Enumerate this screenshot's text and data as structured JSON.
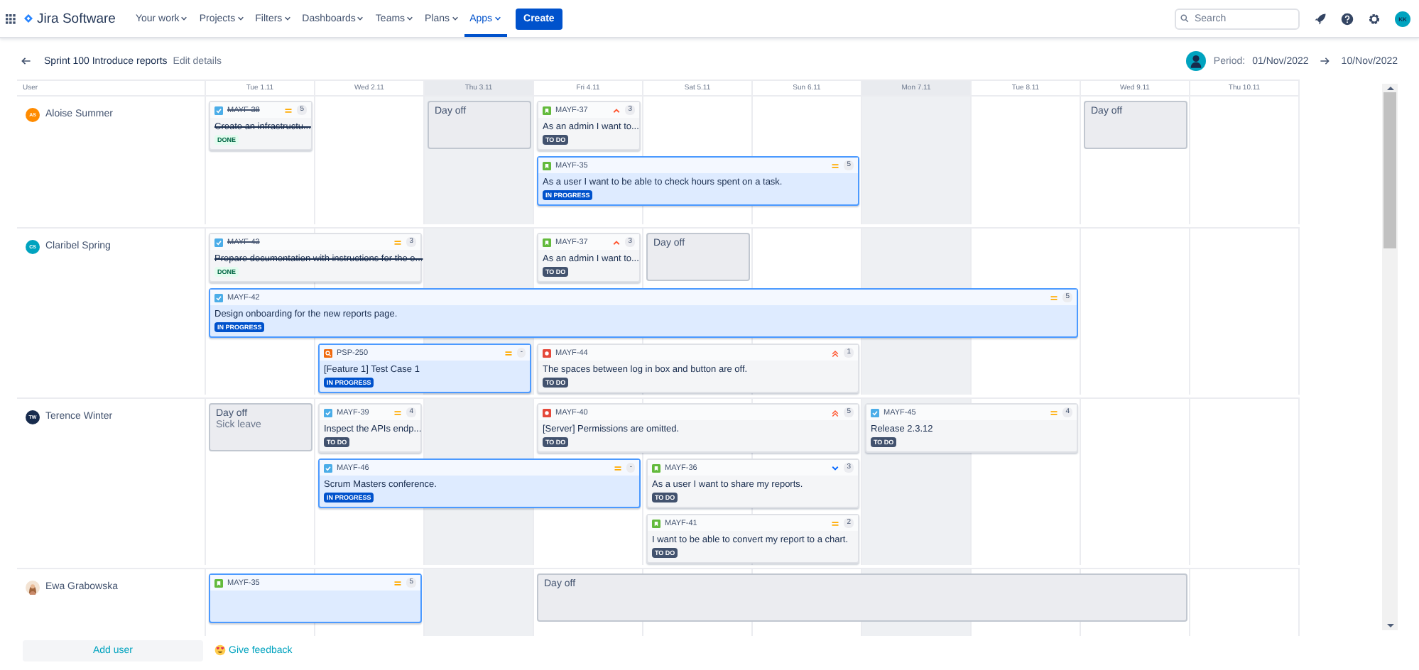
{
  "app": {
    "name": "Jira Software"
  },
  "nav": [
    {
      "label": "Your work",
      "selected": false
    },
    {
      "label": "Projects",
      "selected": false
    },
    {
      "label": "Filters",
      "selected": false
    },
    {
      "label": "Dashboards",
      "selected": false
    },
    {
      "label": "Teams",
      "selected": false
    },
    {
      "label": "Plans",
      "selected": false
    },
    {
      "label": "Apps",
      "selected": true
    }
  ],
  "create_button": "Create",
  "search": {
    "placeholder": "Search"
  },
  "account": {
    "initials": "KK"
  },
  "sprint": {
    "title": "Sprint 100 Introduce reports",
    "edit": "Edit details",
    "period_label": "Period:",
    "from": "01/Nov/2022",
    "to": "10/Nov/2022"
  },
  "columns": {
    "user": "User",
    "days": [
      {
        "label": "Tue 1.11",
        "shaded": false
      },
      {
        "label": "Wed 2.11",
        "shaded": false
      },
      {
        "label": "Thu 3.11",
        "shaded": true
      },
      {
        "label": "Fri 4.11",
        "shaded": false
      },
      {
        "label": "Sat 5.11",
        "shaded": false
      },
      {
        "label": "Sun 6.11",
        "shaded": false
      },
      {
        "label": "Mon 7.11",
        "shaded": true
      },
      {
        "label": "Tue 8.11",
        "shaded": false
      },
      {
        "label": "Wed 9.11",
        "shaded": false
      },
      {
        "label": "Thu 10.11",
        "shaded": false
      }
    ]
  },
  "users": [
    {
      "name": "Aloise Summer",
      "kind": "initials",
      "initials": "AS",
      "color": "#ff8b00",
      "lanes": [
        [
          {
            "kind": "issue",
            "type": {
              "kind": "task"
            },
            "key": "MAYF-38",
            "priority": {
              "kind": "medium"
            },
            "estimate": "5",
            "summary": "Create an infrastructu...",
            "status": {
              "label": "DONE",
              "kind": "done"
            }
          },
          {
            "kind": "empty"
          },
          {
            "kind": "dayoff",
            "label": "Day off"
          },
          {
            "kind": "issue",
            "type": {
              "kind": "story"
            },
            "key": "MAYF-37",
            "priority": {
              "kind": "high"
            },
            "estimate": "3",
            "summary": "As an admin I want to...",
            "status": {
              "label": "TO DO",
              "kind": "todo"
            }
          },
          {
            "kind": "empty"
          },
          {
            "kind": "empty"
          },
          {
            "kind": "empty"
          },
          {
            "kind": "empty"
          },
          {
            "kind": "dayoff",
            "label": "Day off"
          },
          {
            "kind": "empty"
          }
        ],
        [
          {
            "kind": "empty"
          },
          {
            "kind": "empty"
          },
          {
            "kind": "empty"
          },
          {
            "kind": "issue",
            "type": {
              "kind": "story"
            },
            "key": "MAYF-35",
            "priority": {
              "kind": "medium"
            },
            "estimate": "5",
            "summary": "As a user I want to be able to check hours spent on a task.",
            "status": {
              "label": "IN PROGRESS",
              "kind": "inprogress"
            }
          },
          {
            "kind": "more"
          },
          {
            "kind": "more"
          },
          {
            "kind": "empty"
          },
          {
            "kind": "empty"
          },
          {
            "kind": "empty"
          },
          {
            "kind": "empty"
          }
        ]
      ]
    },
    {
      "name": "Claribel Spring",
      "kind": "initials",
      "initials": "CS",
      "color": "#00a3bf",
      "lanes": [
        [
          {
            "kind": "issue",
            "type": {
              "kind": "task"
            },
            "key": "MAYF-43",
            "priority": {
              "kind": "medium"
            },
            "estimate": "3",
            "summary": "Prepare documentation with instructions for the e...",
            "status": {
              "label": "DONE",
              "kind": "done"
            }
          },
          {
            "kind": "more"
          },
          {
            "kind": "empty"
          },
          {
            "kind": "issue",
            "type": {
              "kind": "story"
            },
            "key": "MAYF-37",
            "priority": {
              "kind": "high"
            },
            "estimate": "3",
            "summary": "As an admin I want to...",
            "status": {
              "label": "TO DO",
              "kind": "todo"
            }
          },
          {
            "kind": "dayoff",
            "label": "Day off"
          },
          {
            "kind": "empty"
          },
          {
            "kind": "empty"
          },
          {
            "kind": "empty"
          },
          {
            "kind": "empty"
          },
          {
            "kind": "empty"
          }
        ],
        [
          {
            "kind": "issue",
            "type": {
              "kind": "task"
            },
            "key": "MAYF-42",
            "priority": {
              "kind": "medium"
            },
            "estimate": "5",
            "summary": "Design onboarding for the new reports page.",
            "status": {
              "label": "IN PROGRESS",
              "kind": "inprogress"
            }
          },
          {
            "kind": "more"
          },
          {
            "kind": "more"
          },
          {
            "kind": "more"
          },
          {
            "kind": "more"
          },
          {
            "kind": "more"
          },
          {
            "kind": "more"
          },
          {
            "kind": "more"
          },
          {
            "kind": "empty"
          },
          {
            "kind": "empty"
          }
        ],
        [
          {
            "kind": "empty"
          },
          {
            "kind": "issue",
            "type": {
              "kind": "test"
            },
            "key": "PSP-250",
            "priority": {
              "kind": "medium"
            },
            "estimate": "-",
            "summary": "[Feature 1] Test Case 1",
            "status": {
              "label": "IN PROGRESS",
              "kind": "inprogress"
            }
          },
          {
            "kind": "more"
          },
          {
            "kind": "issue",
            "type": {
              "kind": "bug"
            },
            "key": "MAYF-44",
            "priority": {
              "kind": "highest"
            },
            "estimate": "1",
            "summary": "The spaces between log in box and button are off.",
            "status": {
              "label": "TO DO",
              "kind": "todo"
            }
          },
          {
            "kind": "more"
          },
          {
            "kind": "more"
          },
          {
            "kind": "empty"
          },
          {
            "kind": "empty"
          },
          {
            "kind": "empty"
          },
          {
            "kind": "empty"
          }
        ]
      ]
    },
    {
      "name": "Terence Winter",
      "kind": "initials",
      "initials": "TW",
      "color": "#172b4d",
      "lanes": [
        [
          {
            "kind": "dayoff",
            "label": "Day off",
            "note": "Sick leave"
          },
          {
            "kind": "issue",
            "type": {
              "kind": "task"
            },
            "key": "MAYF-39",
            "priority": {
              "kind": "medium"
            },
            "estimate": "4",
            "summary": "Inspect the APIs endp...",
            "status": {
              "label": "TO DO",
              "kind": "todo"
            }
          },
          {
            "kind": "empty"
          },
          {
            "kind": "issue",
            "type": {
              "kind": "bug"
            },
            "key": "MAYF-40",
            "priority": {
              "kind": "highest"
            },
            "estimate": "5",
            "summary": "[Server] Permissions are omitted.",
            "status": {
              "label": "TO DO",
              "kind": "todo"
            }
          },
          {
            "kind": "more"
          },
          {
            "kind": "more"
          },
          {
            "kind": "issue",
            "type": {
              "kind": "task"
            },
            "key": "MAYF-45",
            "priority": {
              "kind": "medium"
            },
            "estimate": "4",
            "summary": "Release 2.3.12",
            "status": {
              "label": "TO DO",
              "kind": "todo"
            }
          },
          {
            "kind": "more"
          },
          {
            "kind": "empty"
          },
          {
            "kind": "empty"
          }
        ],
        [
          {
            "kind": "empty"
          },
          {
            "kind": "issue",
            "type": {
              "kind": "task"
            },
            "key": "MAYF-46",
            "priority": {
              "kind": "medium"
            },
            "estimate": "-",
            "summary": "Scrum Masters conference.",
            "status": {
              "label": "IN PROGRESS",
              "kind": "inprogress"
            }
          },
          {
            "kind": "more"
          },
          {
            "kind": "more"
          },
          {
            "kind": "issue",
            "type": {
              "kind": "story"
            },
            "key": "MAYF-36",
            "priority": {
              "kind": "low"
            },
            "estimate": "3",
            "summary": "As a user I want to share my reports.",
            "status": {
              "label": "TO DO",
              "kind": "todo"
            }
          },
          {
            "kind": "more"
          },
          {
            "kind": "empty"
          },
          {
            "kind": "empty"
          },
          {
            "kind": "empty"
          },
          {
            "kind": "empty"
          }
        ],
        [
          {
            "kind": "empty"
          },
          {
            "kind": "empty"
          },
          {
            "kind": "empty"
          },
          {
            "kind": "empty"
          },
          {
            "kind": "issue",
            "type": {
              "kind": "story"
            },
            "key": "MAYF-41",
            "priority": {
              "kind": "medium"
            },
            "estimate": "2",
            "summary": "I want to be able to convert my report to a chart.",
            "status": {
              "label": "TO DO",
              "kind": "todo"
            }
          },
          {
            "kind": "more"
          },
          {
            "kind": "empty"
          },
          {
            "kind": "empty"
          },
          {
            "kind": "empty"
          },
          {
            "kind": "empty"
          }
        ]
      ]
    },
    {
      "name": "Ewa Grabowska",
      "kind": "photo",
      "lanes": [
        [
          {
            "kind": "issue",
            "type": {
              "kind": "story"
            },
            "key": "MAYF-35",
            "priority": {
              "kind": "medium"
            },
            "estimate": "5",
            "status": {
              "kind": "inprogress"
            }
          },
          {
            "kind": "more"
          },
          {
            "kind": "empty"
          },
          {
            "kind": "dayoff",
            "label": "Day off"
          },
          {
            "kind": "more"
          },
          {
            "kind": "more"
          },
          {
            "kind": "more"
          },
          {
            "kind": "more"
          },
          {
            "kind": "more"
          },
          {
            "kind": "empty"
          }
        ]
      ]
    }
  ],
  "footer": {
    "add_user": "Add user",
    "feedback": "Give feedback"
  }
}
